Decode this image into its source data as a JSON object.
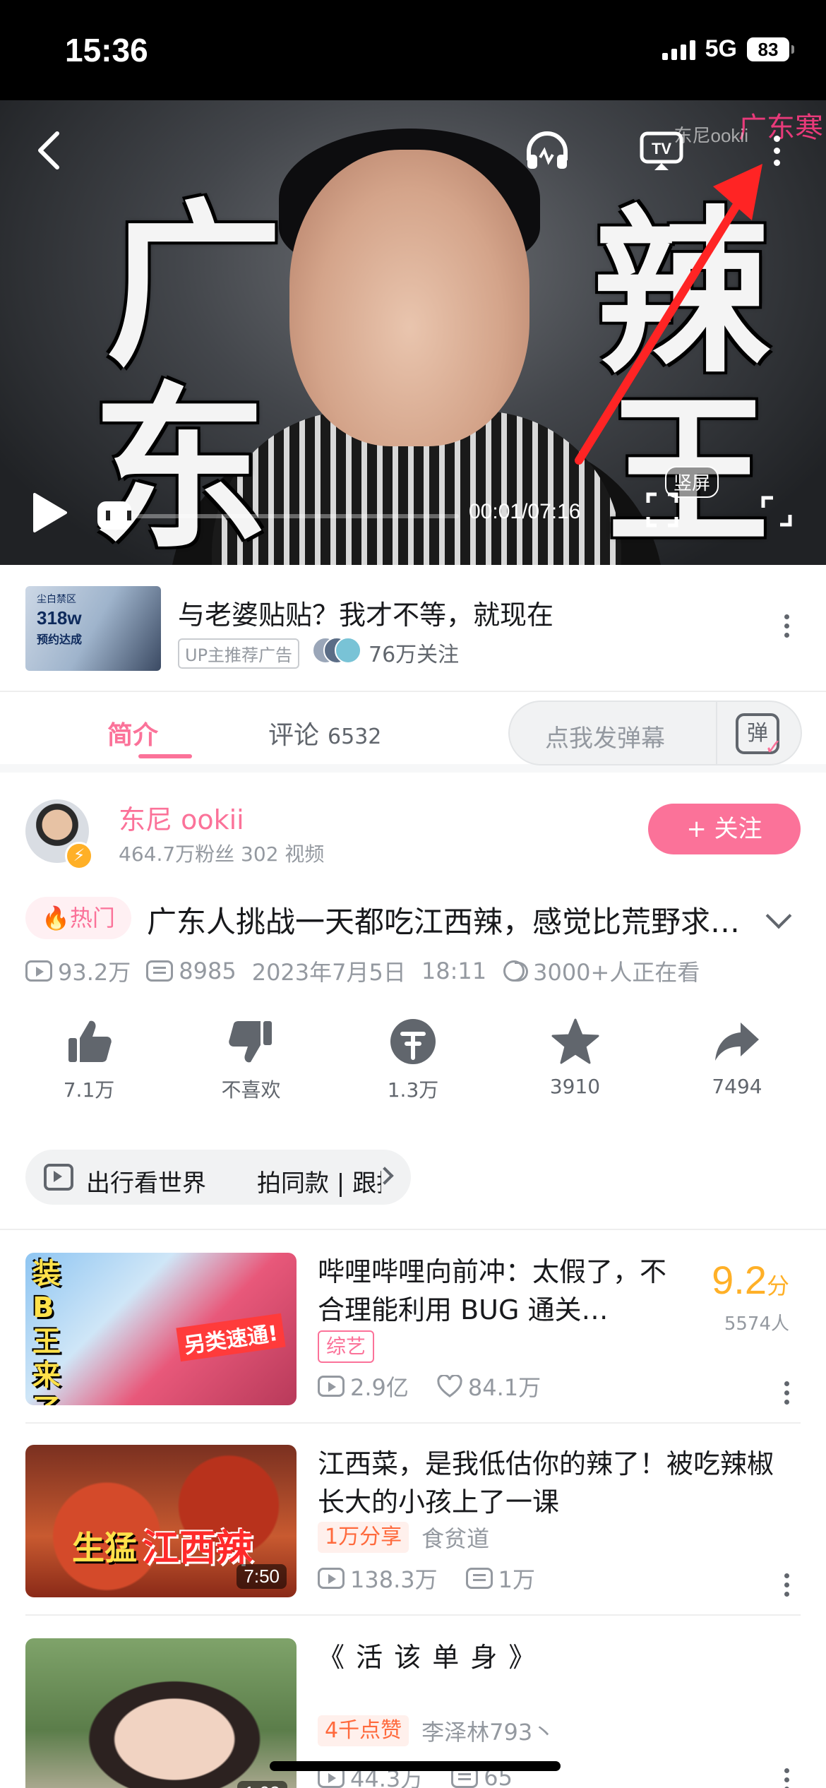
{
  "status_bar": {
    "time": "15:36",
    "network": "5G",
    "battery": "83"
  },
  "video": {
    "time": "00:01/07:16",
    "progress": 0.002,
    "portrait_label": "竖屏",
    "overlay_chars": [
      "广",
      "东",
      "辣",
      "王"
    ],
    "watermark_pink": "广东寒",
    "watermark_grey": "东尼ookii"
  },
  "ad": {
    "thumb_top": "尘白禁区",
    "thumb_title": "318w",
    "thumb_sub": "预约达成",
    "title": "与老婆贴贴？我才不等，就现在",
    "tag": "UP主推荐广告",
    "followers": "76万关注"
  },
  "tabs": {
    "intro": "简介",
    "comments": "评论",
    "comment_count": "6532",
    "danmaku_placeholder": "点我发弹幕",
    "danmaku_icon": "弹"
  },
  "uploader": {
    "name": "东尼 ookii",
    "stats": "464.7万粉丝   302 视频",
    "follow": "+ 关注"
  },
  "video_info": {
    "hot": "热门",
    "title": "广东人挑战一天都吃江西辣，感觉比荒野求生还难",
    "views": "93.2万",
    "danmaku": "8985",
    "date": "2023年7月5日",
    "time": "18:11",
    "watching": "3000+人正在看"
  },
  "actions": [
    {
      "label": "7.1万",
      "icon": "thumbs-up-icon"
    },
    {
      "label": "不喜欢",
      "icon": "thumbs-down-icon"
    },
    {
      "label": "1.3万",
      "icon": "coin-icon"
    },
    {
      "label": "3910",
      "icon": "star-icon"
    },
    {
      "label": "7494",
      "icon": "share-icon"
    }
  ],
  "topics": {
    "first": "出行看世界",
    "second": "拍同款 | 跟拍"
  },
  "recommendations": [
    {
      "title": "哔哩哔哩向前冲：太假了，不合理能利用 BUG 通关…",
      "tag": "综艺",
      "views": "2.9亿",
      "likes": "84.1万",
      "score": "9.2",
      "score_unit": "分",
      "score_count": "5574人",
      "thumb_text1": "装B王来了",
      "thumb_text2": "另类速通!"
    },
    {
      "title": "江西菜，是我低估你的辣了！被吃辣椒长大的小孩上了一课",
      "badge": "1万分享",
      "up": "食贫道",
      "views": "138.3万",
      "danmaku": "1万",
      "duration": "7:50",
      "thumb_text1": "生猛",
      "thumb_text2": "江西辣"
    },
    {
      "title": "《 活 该 单 身 》",
      "badge": "4千点赞",
      "up": "李泽林793丶",
      "views": "44.3万",
      "danmaku": "65",
      "duration": "1:03"
    }
  ],
  "colors": {
    "accent": "#fb7299",
    "score": "#ffb027",
    "annotation_arrow": "#ff2424"
  }
}
